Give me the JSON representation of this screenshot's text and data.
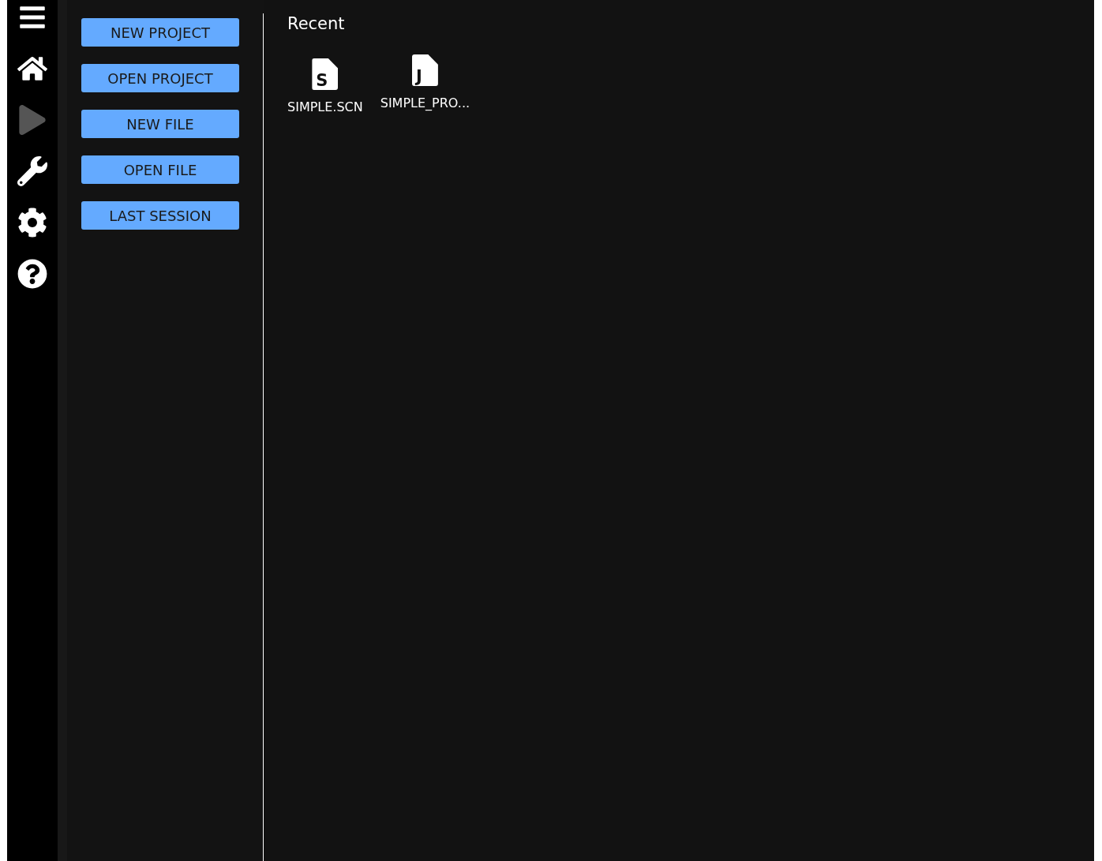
{
  "sidebar": {
    "items": [
      {
        "kind": "menu",
        "disabled": false
      },
      {
        "kind": "home",
        "disabled": false
      },
      {
        "kind": "play",
        "disabled": true
      },
      {
        "kind": "tools",
        "disabled": false
      },
      {
        "kind": "settings",
        "disabled": false
      },
      {
        "kind": "help",
        "disabled": false
      }
    ]
  },
  "actions": [
    "NEW PROJECT",
    "OPEN PROJECT",
    "NEW FILE",
    "OPEN FILE",
    "LAST SESSION"
  ],
  "recent": {
    "title": "Recent",
    "files": [
      {
        "letter": "S",
        "name": "SIMPLE.SCN"
      },
      {
        "letter": "J",
        "name": "SIMPLE_PRO..."
      }
    ]
  }
}
